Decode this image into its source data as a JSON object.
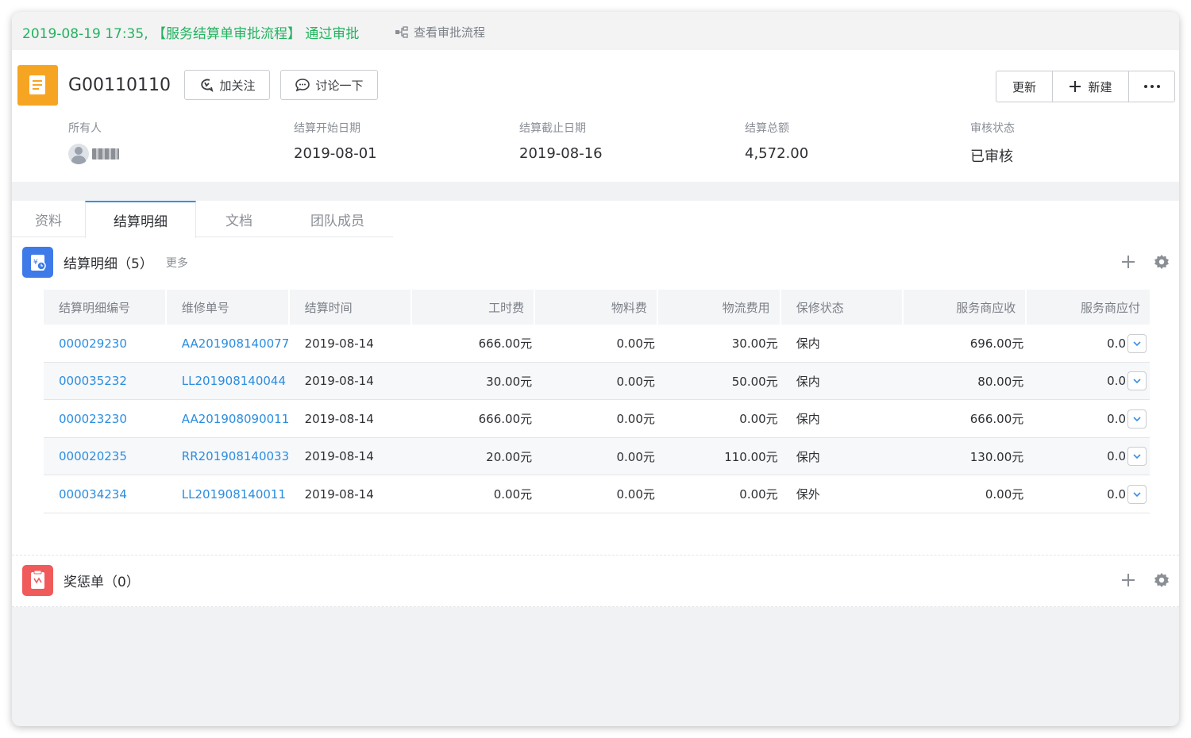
{
  "approval": {
    "text": "2019-08-19 17:35, 【服务结算单审批流程】 通过审批",
    "flow_link": "查看审批流程"
  },
  "header": {
    "code": "G00110110",
    "follow_label": "加关注",
    "discuss_label": "讨论一下",
    "update_label": "更新",
    "new_label": "新建",
    "more_label": "···"
  },
  "fields": {
    "owner_label": "所有人",
    "owner_name": "",
    "start_label": "结算开始日期",
    "start_value": "2019-08-01",
    "end_label": "结算截止日期",
    "end_value": "2019-08-16",
    "total_label": "结算总额",
    "total_value": "4,572.00",
    "status_label": "审核状态",
    "status_value": "已审核"
  },
  "tabs": [
    "资料",
    "结算明细",
    "文档",
    "团队成员"
  ],
  "detail_section": {
    "title": "结算明细（5）",
    "more": "更多"
  },
  "table": {
    "headers": [
      "结算明细编号",
      "维修单号",
      "结算时间",
      "工时费",
      "物料费",
      "物流费用",
      "保修状态",
      "服务商应收",
      "服务商应付"
    ],
    "rows": [
      [
        "000029230",
        "AA201908140077",
        "2019-08-14",
        "666.00元",
        "0.00元",
        "30.00元",
        "保内",
        "696.00元",
        "0.0"
      ],
      [
        "000035232",
        "LL201908140044",
        "2019-08-14",
        "30.00元",
        "0.00元",
        "50.00元",
        "保内",
        "80.00元",
        "0.0"
      ],
      [
        "000023230",
        "AA201908090011",
        "2019-08-14",
        "666.00元",
        "0.00元",
        "0.00元",
        "保内",
        "666.00元",
        "0.0"
      ],
      [
        "000020235",
        "RR201908140033",
        "2019-08-14",
        "20.00元",
        "0.00元",
        "110.00元",
        "保内",
        "130.00元",
        "0.0"
      ],
      [
        "000034234",
        "LL201908140011",
        "2019-08-14",
        "0.00元",
        "0.00元",
        "0.00元",
        "保外",
        "0.00元",
        "0.0"
      ]
    ]
  },
  "reward_section": {
    "title": "奖惩单（0）"
  },
  "colors": {
    "approval_green": "#22b35e",
    "link_blue": "#2a8de0",
    "doc_icon": "#f6a523",
    "section_blue": "#3e7be8",
    "section_red": "#f05a5a"
  },
  "icons": [
    "flow-chart-icon",
    "document-icon",
    "follow-icon",
    "comment-icon",
    "plus-icon",
    "more-icon",
    "settlement-icon",
    "reward-icon",
    "gear-icon",
    "chevron-down-icon"
  ]
}
